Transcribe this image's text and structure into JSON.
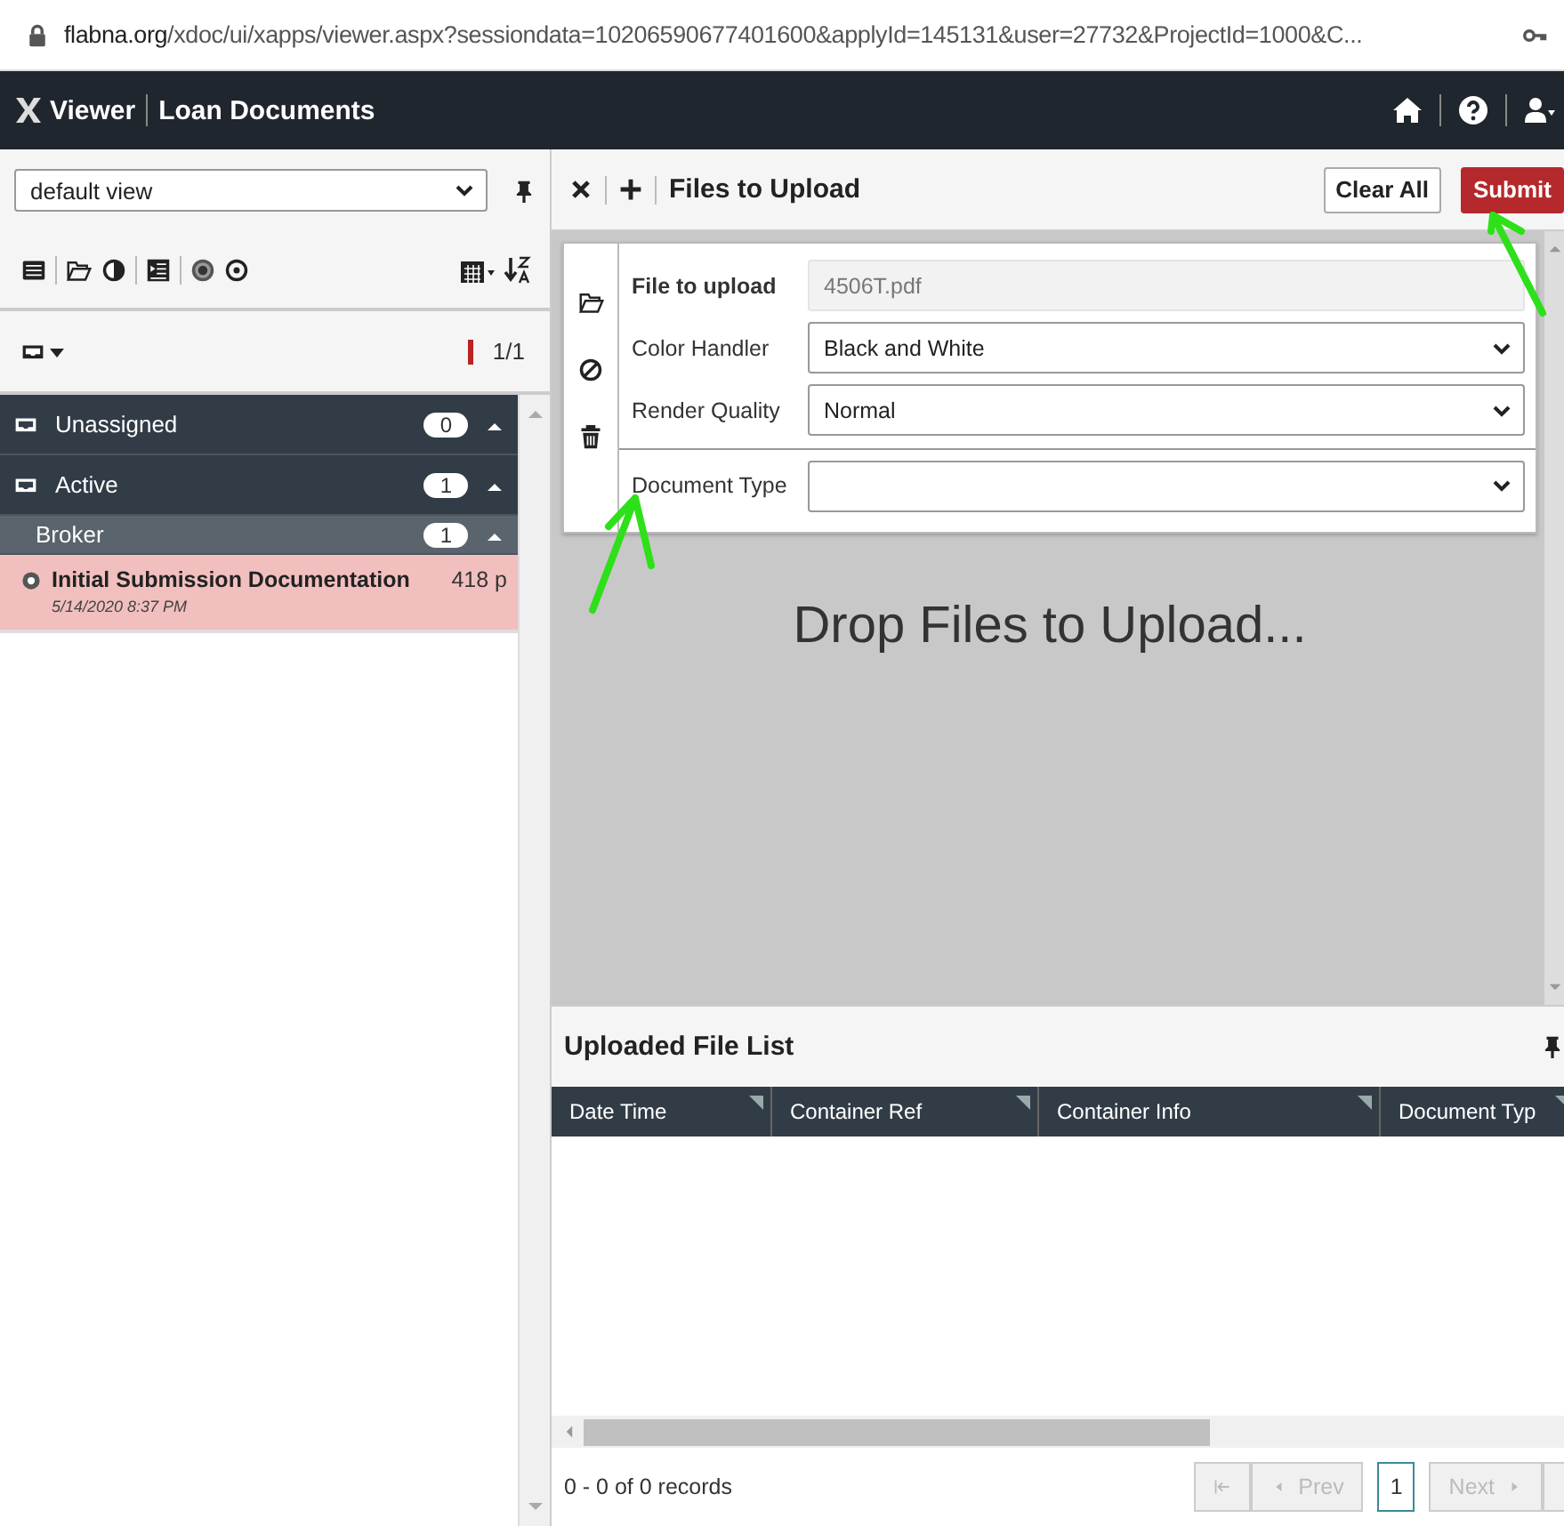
{
  "browser": {
    "domain": "flabna.org",
    "path": "/xdoc/ui/xapps/viewer.aspx?sessiondata=10206590677401600&applyId=145131&user=27732&ProjectId=1000&C..."
  },
  "header": {
    "app_name": "Viewer",
    "title": "Loan Documents"
  },
  "sidebar": {
    "view_select": "default view",
    "count": "1/1",
    "groups": [
      {
        "label": "Unassigned",
        "count": "0",
        "kind": "group"
      },
      {
        "label": "Active",
        "count": "1",
        "kind": "group"
      },
      {
        "label": "Broker",
        "count": "1",
        "kind": "subgroup"
      }
    ],
    "documents": [
      {
        "title": "Initial Submission Documentation",
        "date": "5/14/2020 8:37 PM",
        "pages": "418 p",
        "selected": true
      }
    ]
  },
  "upload": {
    "title": "Files to Upload",
    "buttons": [
      {
        "label": "Clear All",
        "kind": "default"
      },
      {
        "label": "Submit",
        "kind": "primary"
      }
    ],
    "fields": [
      {
        "label": "File to upload",
        "value": "4506T.pdf",
        "kind": "readonly",
        "separated": false
      },
      {
        "label": "Color Handler",
        "value": "Black and White",
        "kind": "select",
        "separated": false
      },
      {
        "label": "Render Quality",
        "value": "Normal",
        "kind": "select",
        "separated": false
      },
      {
        "label": "Document Type",
        "kind": "select",
        "separated": true
      }
    ],
    "drop_text": "Drop Files to Upload..."
  },
  "file_list": {
    "title": "Uploaded File List",
    "columns": [
      "Date Time",
      "Container Ref",
      "Container Info",
      "Document Typ"
    ],
    "status": "0 - 0 of 0 records",
    "pager": [
      {
        "kind": "first",
        "disabled": true
      },
      {
        "kind": "prev",
        "label": "Prev",
        "disabled": true
      },
      {
        "kind": "page",
        "label": "1",
        "selected": true
      },
      {
        "kind": "next",
        "label": "Next",
        "disabled": true
      },
      {
        "kind": "last",
        "disabled": true
      }
    ]
  }
}
